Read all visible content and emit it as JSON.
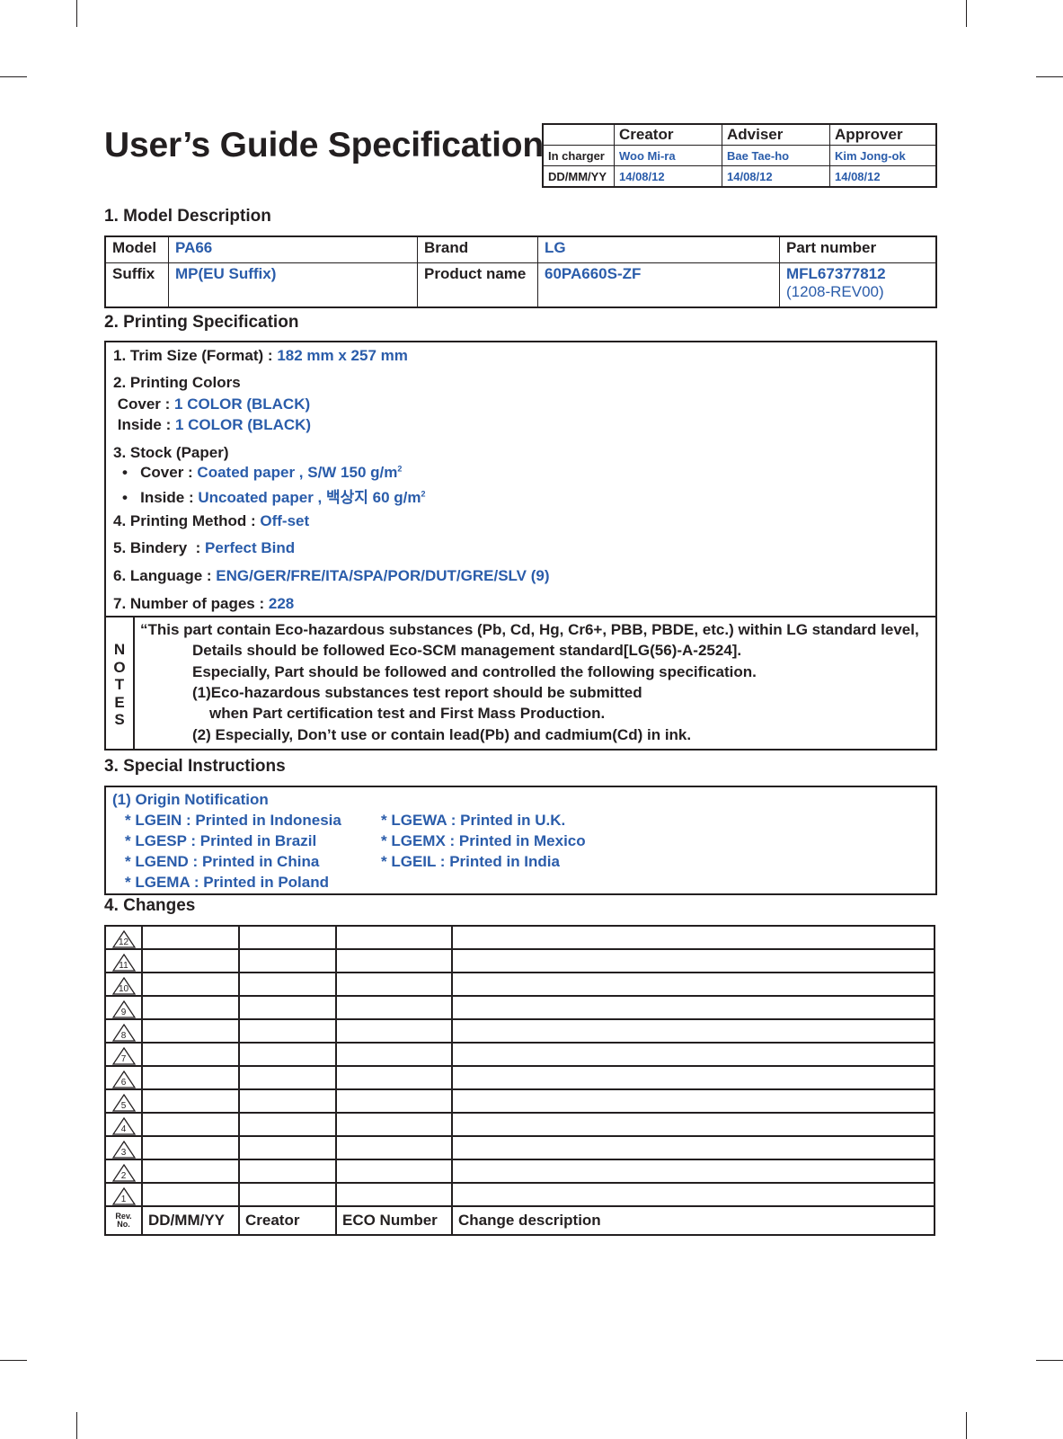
{
  "title": "User’s Guide Specification",
  "approval": {
    "headers": [
      "",
      "Creator",
      "Adviser",
      "Approver"
    ],
    "rows": [
      {
        "label": "In charger",
        "values": [
          "Woo Mi-ra",
          "Bae Tae-ho",
          "Kim Jong-ok"
        ]
      },
      {
        "label": "DD/MM/YY",
        "values": [
          "14/08/12",
          "14/08/12",
          "14/08/12"
        ]
      }
    ]
  },
  "sections": {
    "model": "1. Model Description",
    "printing": "2. Printing Specification",
    "special": "3. Special Instructions",
    "changes": "4. Changes"
  },
  "model": {
    "model_label": "Model",
    "model_value": "PA66",
    "brand_label": "Brand",
    "brand_value": "LG",
    "part_label": "Part number",
    "suffix_label": "Suffix",
    "suffix_value": "MP(EU Suffix)",
    "product_label": "Product name",
    "product_value": "60PA660S-ZF",
    "part_value": "MFL67377812",
    "part_rev": "(1208-REV00)"
  },
  "printing": {
    "trim_label": "1. Trim Size (Format) : ",
    "trim_value": "182 mm x 257 mm",
    "colors_label": "2. Printing Colors",
    "cover_color_label": " Cover : ",
    "cover_color_value": "1 COLOR (BLACK)",
    "inside_color_label": " Inside : ",
    "inside_color_value": "1 COLOR (BLACK)",
    "stock_label": "3. Stock (Paper)",
    "stock_cover_label": "Cover : ",
    "stock_cover_value": "Coated paper , S/W 150 g/m",
    "stock_inside_label": "Inside : ",
    "stock_inside_value": "Uncoated paper , 백상지 60 g/m",
    "superscript": "2",
    "bullet": "•",
    "method_label": "4. Printing Method : ",
    "method_value": "Off-set",
    "bindery_label": "5. Bindery  : ",
    "bindery_value": "Perfect Bind",
    "language_label": "6. Language : ",
    "language_value": "ENG/GER/FRE/ITA/SPA/POR/DUT/GRE/SLV (9)",
    "pages_label": "7. Number of pages : ",
    "pages_value": "228"
  },
  "notes": {
    "label_letters": [
      "N",
      "O",
      "T",
      "E",
      "S"
    ],
    "lines": [
      "“This part contain Eco-hazardous substances (Pb, Cd, Hg, Cr6+, PBB, PBDE, etc.) within LG standard level,",
      "Details should be followed Eco-SCM management standard[LG(56)-A-2524].",
      "Especially, Part should be followed and controlled the following specification.",
      "(1)Eco-hazardous substances test report should be submitted",
      "when  Part certification test and First Mass Production.",
      "(2) Especially, Don’t use or contain lead(Pb) and cadmium(Cd) in ink."
    ]
  },
  "special": {
    "heading": "(1) Origin Notification",
    "left": [
      "* LGEIN : Printed in Indonesia",
      "* LGESP : Printed in Brazil",
      "* LGEND : Printed in China",
      "* LGEMA : Printed in Poland"
    ],
    "right": [
      "* LGEWA : Printed in U.K.",
      "* LGEMX : Printed in Mexico",
      "* LGEIL : Printed in India"
    ]
  },
  "changes": {
    "revisions": [
      "12",
      "11",
      "10",
      "9",
      "8",
      "7",
      "6",
      "5",
      "4",
      "3",
      "2",
      "1"
    ],
    "rev_label_1": "Rev.",
    "rev_label_2": "No.",
    "columns": [
      "DD/MM/YY",
      "Creator",
      "ECO Number",
      "Change description"
    ]
  }
}
